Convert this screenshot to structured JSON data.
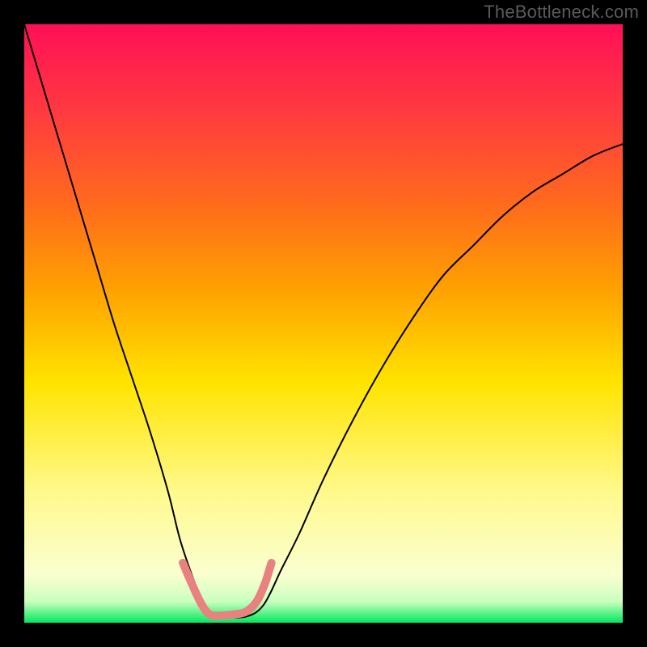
{
  "watermark": "TheBottleneck.com",
  "chart_data": {
    "type": "line",
    "title": "",
    "xlabel": "",
    "ylabel": "",
    "xlim": [
      0,
      100
    ],
    "ylim": [
      0,
      100
    ],
    "note": "Axes are unlabeled; x and y expressed as 0-100 percentages of the plot area (x left→right, y bottom→top). Values estimated from pixels.",
    "background": {
      "type": "vertical-gradient",
      "stops": [
        {
          "pos": 0.0,
          "color": "#ff0f57"
        },
        {
          "pos": 0.15,
          "color": "#ff3b3f"
        },
        {
          "pos": 0.3,
          "color": "#ff6a1c"
        },
        {
          "pos": 0.45,
          "color": "#ffa400"
        },
        {
          "pos": 0.6,
          "color": "#ffe400"
        },
        {
          "pos": 0.78,
          "color": "#fff98c"
        },
        {
          "pos": 0.92,
          "color": "#faffd0"
        },
        {
          "pos": 0.965,
          "color": "#c9ffbe"
        },
        {
          "pos": 1.0,
          "color": "#00e85c"
        }
      ]
    },
    "series": [
      {
        "name": "curve",
        "color": "#000000",
        "width": 2,
        "x": [
          0,
          3,
          6,
          9,
          12,
          15,
          18,
          21,
          24,
          26,
          28,
          30,
          31,
          33,
          37,
          40,
          43,
          46,
          50,
          55,
          60,
          65,
          70,
          75,
          80,
          85,
          90,
          95,
          100
        ],
        "y": [
          100,
          90,
          80,
          70,
          60,
          50,
          41,
          32,
          22,
          14,
          8,
          3,
          1,
          1,
          1,
          3,
          9,
          15,
          24,
          34,
          43,
          51,
          58,
          63,
          68,
          72,
          75,
          78,
          80
        ]
      },
      {
        "name": "highlight",
        "color": "#e8817f",
        "width": 10,
        "linecap": "round",
        "x": [
          26.5,
          28.0,
          29.4,
          30.5,
          31.5,
          33.0,
          35.0,
          37.0,
          38.8,
          40.2,
          41.3
        ],
        "y": [
          10.0,
          6.5,
          3.5,
          1.8,
          1.2,
          1.2,
          1.4,
          1.8,
          3.5,
          6.5,
          10.0
        ]
      }
    ]
  }
}
